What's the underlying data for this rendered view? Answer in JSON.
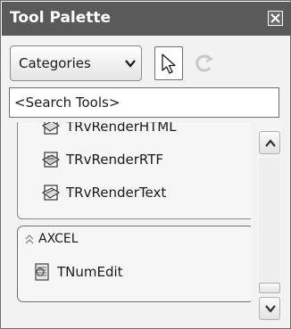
{
  "window": {
    "title": "Tool Palette",
    "close_icon": "close-icon"
  },
  "toolbar": {
    "categories_label": "Categories",
    "categories_icon": "chevron-down-icon",
    "pointer_icon": "arrow-pointer-icon",
    "refresh_icon": "refresh-icon"
  },
  "search": {
    "placeholder": "<Search Tools>"
  },
  "palette": {
    "items": [
      {
        "label": "TRvRenderHTML",
        "icon": "render-html-icon"
      },
      {
        "label": "TRvRenderRTF",
        "icon": "render-rtf-icon"
      },
      {
        "label": "TRvRenderText",
        "icon": "render-text-icon"
      }
    ],
    "groups": [
      {
        "label": "AXCEL",
        "icon": "collapse-chevrons-icon",
        "items": [
          {
            "label": "TNumEdit",
            "icon": "numedit-icon"
          }
        ]
      }
    ]
  },
  "colors": {
    "titlebar": "#5a5a5a",
    "panel": "#f2f2f2",
    "border": "#6f6f6f"
  }
}
